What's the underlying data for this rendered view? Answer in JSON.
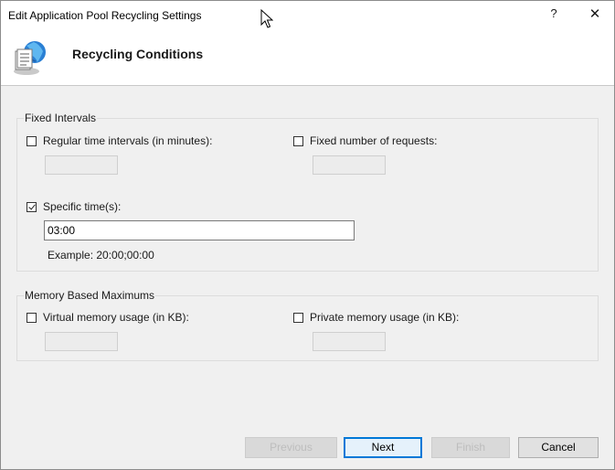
{
  "window": {
    "title": "Edit Application Pool Recycling Settings",
    "help_label": "?",
    "close_label": "✕"
  },
  "header": {
    "title": "Recycling Conditions",
    "icon": "recycle-globe-icon"
  },
  "fixed_intervals": {
    "group_label": "Fixed Intervals",
    "regular_time": {
      "label": "Regular time intervals (in minutes):",
      "checked": false,
      "value": ""
    },
    "fixed_requests": {
      "label": "Fixed number of requests:",
      "checked": false,
      "value": ""
    },
    "specific_time": {
      "label": "Specific time(s):",
      "checked": true,
      "value": "03:00"
    },
    "example": "Example: 20:00;00:00"
  },
  "memory": {
    "group_label": "Memory Based Maximums",
    "virtual": {
      "label": "Virtual memory usage (in KB):",
      "checked": false,
      "value": ""
    },
    "private": {
      "label": "Private memory usage (in KB):",
      "checked": false,
      "value": ""
    }
  },
  "buttons": {
    "previous": "Previous",
    "next": "Next",
    "finish": "Finish",
    "cancel": "Cancel"
  }
}
